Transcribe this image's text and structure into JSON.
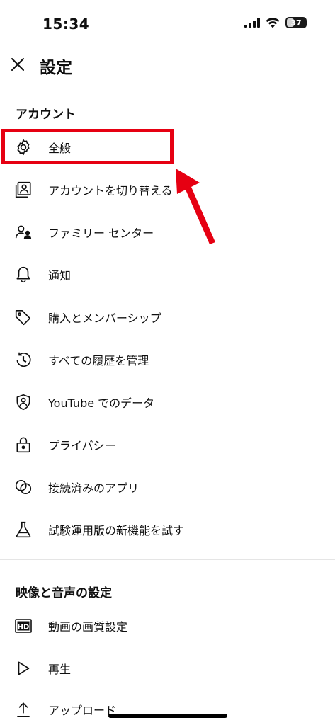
{
  "status_bar": {
    "time": "15:34",
    "battery": "37"
  },
  "header": {
    "title": "設定"
  },
  "sections": {
    "account": {
      "title": "アカウント",
      "items": [
        {
          "label": "全般",
          "icon": "gear-icon"
        },
        {
          "label": "アカウントを切り替える",
          "icon": "switch-account-icon"
        },
        {
          "label": "ファミリー センター",
          "icon": "family-icon"
        },
        {
          "label": "通知",
          "icon": "bell-icon"
        },
        {
          "label": "購入とメンバーシップ",
          "icon": "tag-icon"
        },
        {
          "label": "すべての履歴を管理",
          "icon": "history-icon"
        },
        {
          "label": "YouTube でのデータ",
          "icon": "shield-person-icon"
        },
        {
          "label": "プライバシー",
          "icon": "lock-icon"
        },
        {
          "label": "接続済みのアプリ",
          "icon": "connected-apps-icon"
        },
        {
          "label": "試験運用版の新機能を試す",
          "icon": "flask-icon"
        }
      ]
    },
    "video_audio": {
      "title": "映像と音声の設定",
      "items": [
        {
          "label": "動画の画質設定",
          "icon": "hd-icon"
        },
        {
          "label": "再生",
          "icon": "play-icon"
        },
        {
          "label": "アップロード",
          "icon": "upload-icon"
        }
      ]
    }
  },
  "annotation": {
    "highlight_color": "#e60012"
  }
}
